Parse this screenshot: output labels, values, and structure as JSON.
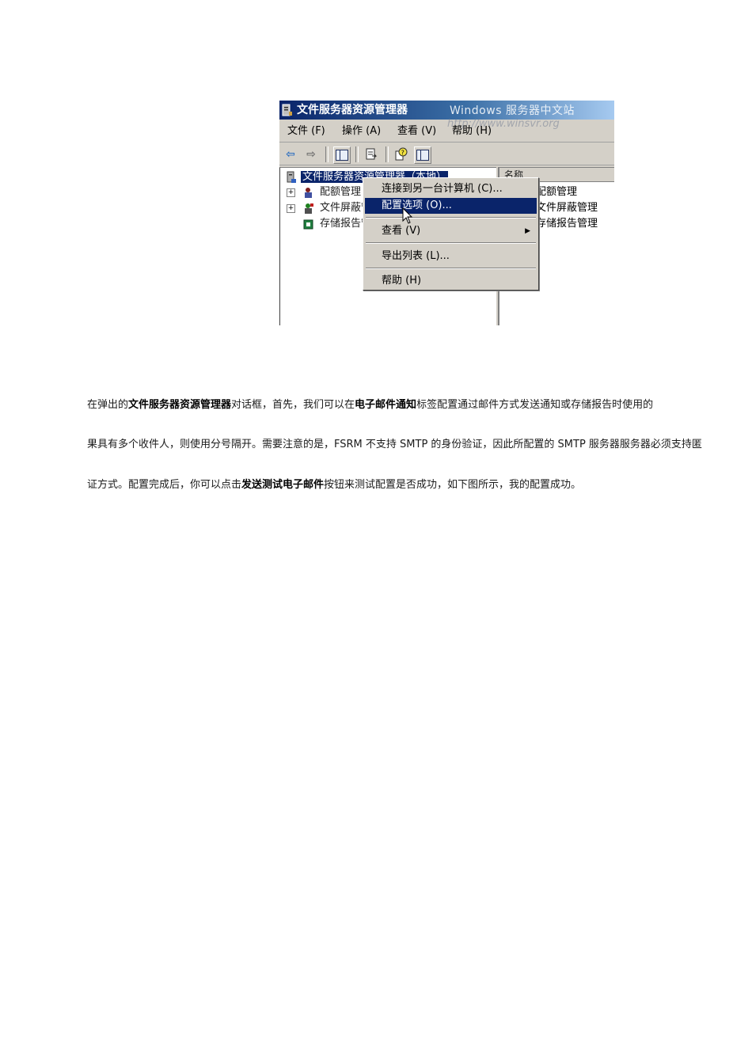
{
  "screenshot": {
    "window_title": "文件服务器资源管理器",
    "watermark": "Windows 服务器中文站",
    "watermark_url": "http://www.winsvr.org",
    "menu": [
      "文件 (F)",
      "操作 (A)",
      "查看 (V)",
      "帮助 (H)"
    ],
    "tree": {
      "root": "文件服务器资源管理器（本地）",
      "items": [
        "配额管理",
        "文件屏蔽管理",
        "存储报告管理"
      ]
    },
    "tree_visible": [
      "配额管理",
      "文件屏蔽管理",
      "存储报告管理"
    ],
    "right_pane": {
      "column": "名称",
      "items": [
        "配额管理",
        "文件屏蔽管理",
        "存储报告管理"
      ]
    },
    "context_menu": {
      "items": [
        "连接到另一台计算机 (C)...",
        "配置选项 (O)...",
        "查看 (V)",
        "导出列表 (L)...",
        "帮助 (H)"
      ],
      "highlighted": "配置选项 (O)..."
    },
    "colors": {
      "title_bar": "#0a246a",
      "highlight": "#0a246a",
      "face": "#d4d0c8"
    }
  },
  "paragraphs": {
    "p1": {
      "t1": "在弹出的",
      "b1": "文件服务器资源管理器",
      "t2": "对话框，首先，我们可以在",
      "b2": "电子邮件通知",
      "t3": "标签配置通过邮件方式发送通知或存储报告时使用的"
    },
    "p2": {
      "t1": "果具有多个收件人，则使用分号隔开。需要注意的是，",
      "s1": "FSRM",
      "t2": " 不支持 ",
      "s2": "SMTP",
      "t3": " 的身份验证，因此所配置的 ",
      "s3": "SMTP",
      "t4": " 服务器服务器必须支持匿"
    },
    "p3": {
      "t1": "证方式。配置完成后，你可以点击",
      "b1": "发送测试电子邮件",
      "t2": "按钮来测试配置是否成功，如下图所示，我的配置成功。"
    }
  }
}
